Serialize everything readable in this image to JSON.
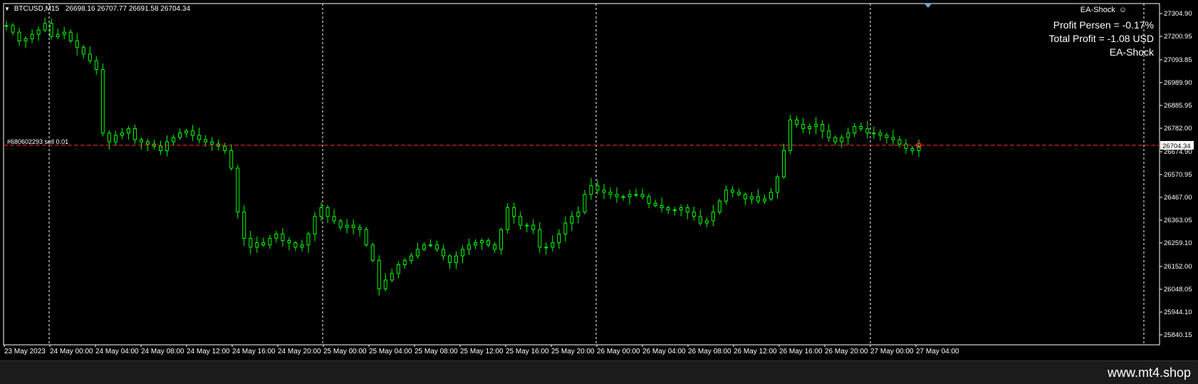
{
  "header": {
    "symbol": "BTCUSD,M15",
    "ohlc": "26698.16 26707.77 26691.58 26704.34"
  },
  "ea_indicator": {
    "label": "EA-Shock",
    "icon": "smiley-icon"
  },
  "info_panel": {
    "profit_percent": "Profit Persen = -0.17%",
    "total_profit": "Total Profit = -1.08 USD",
    "ea_name": "EA-Shock"
  },
  "order_line": {
    "label": "#680602293 sell 0.01",
    "price": 26704.34
  },
  "current_price_label": "26704.34",
  "price_axis": {
    "ticks": [
      "27304.90",
      "27200.95",
      "27093.85",
      "26989.90",
      "26885.95",
      "26782.00",
      "26674.90",
      "26570.95",
      "26467.00",
      "26363.05",
      "26259.10",
      "26152.00",
      "26048.05",
      "25944.10",
      "25840.15"
    ]
  },
  "time_axis": {
    "labels": [
      "23 May 2023",
      "24 May 00:00",
      "24 May 04:00",
      "24 May 08:00",
      "24 May 12:00",
      "24 May 16:00",
      "24 May 20:00",
      "25 May 00:00",
      "25 May 04:00",
      "25 May 08:00",
      "25 May 12:00",
      "25 May 16:00",
      "25 May 20:00",
      "26 May 00:00",
      "26 May 04:00",
      "26 May 08:00",
      "26 May 12:00",
      "26 May 16:00",
      "26 May 20:00",
      "27 May 00:00",
      "27 May 04:00"
    ]
  },
  "colors": {
    "bull": "#00ff00",
    "background": "#000000",
    "grid": "#ffffff",
    "order_line": "#ff3030"
  },
  "chart_data": {
    "type": "line",
    "series": [
      {
        "values": [
          27250,
          27220,
          27180,
          27190,
          27210,
          27230,
          27260,
          27200,
          27210,
          27220,
          27180,
          27150,
          27120,
          27090,
          27050,
          26760,
          26720,
          26750,
          26760,
          26780,
          26730,
          26720,
          26710,
          26700,
          26680,
          26720,
          26740,
          26760,
          26770,
          26750,
          26730,
          26720,
          26710,
          26700,
          26680,
          26600,
          26400,
          26280,
          26240,
          26260,
          26250,
          26280,
          26300,
          26270,
          26260,
          26240,
          26250,
          26300,
          26380,
          26420,
          26380,
          26360,
          26330,
          26340,
          26330,
          26320,
          26250,
          26180,
          26050,
          26090,
          26120,
          26160,
          26180,
          26200,
          26230,
          26250,
          26250,
          26230,
          26200,
          26170,
          26200,
          26230,
          26250,
          26260,
          26270,
          26250,
          26230,
          26320,
          26420,
          26380,
          26340,
          26340,
          26320,
          26240,
          26240,
          26260,
          26300,
          26350,
          26380,
          26400,
          26480,
          26520,
          26500,
          26490,
          26480,
          26470,
          26470,
          26480,
          26480,
          26470,
          26440,
          26430,
          26420,
          26410,
          26410,
          26420,
          26400,
          26380,
          26350,
          26360,
          26400,
          26450,
          26500,
          26490,
          26480,
          26460,
          26470,
          26450,
          26460,
          26490,
          26560,
          26680,
          26820,
          26800,
          26780,
          26790,
          26800,
          26770,
          26740,
          26720,
          26740,
          26760,
          26790,
          26780,
          26760,
          26760,
          26750,
          26740,
          26730,
          26710,
          26690,
          26680,
          26700
        ]
      }
    ],
    "ylim": [
      25840.15,
      27304.9
    ],
    "x_range": [
      "23 May 2023",
      "27 May 04:00"
    ]
  }
}
